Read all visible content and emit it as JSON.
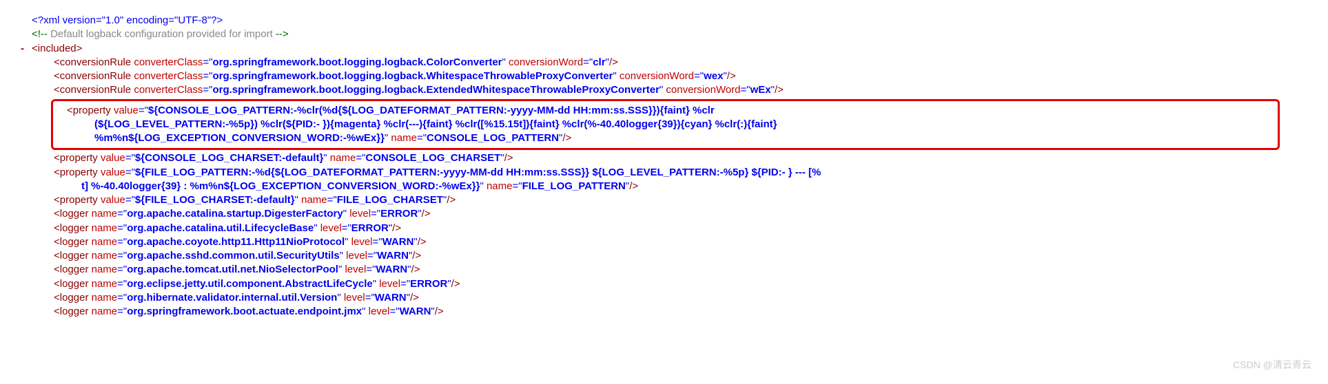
{
  "xmlDecl": "<?xml version=\"1.0\" encoding=\"UTF-8\"?>",
  "comment": " Default logback configuration provided for import ",
  "root": "included",
  "convRules": [
    {
      "class": "org.springframework.boot.logging.logback.ColorConverter",
      "word": "clr"
    },
    {
      "class": "org.springframework.boot.logging.logback.WhitespaceThrowableProxyConverter",
      "word": "wex"
    },
    {
      "class": "org.springframework.boot.logging.logback.ExtendedWhitespaceThrowableProxyConverter",
      "word": "wEx"
    }
  ],
  "props": {
    "console_pattern": {
      "l1": "${CONSOLE_LOG_PATTERN:-%clr(%d{${LOG_DATEFORMAT_PATTERN:-yyyy-MM-dd HH:mm:ss.SSS}}){faint} %clr",
      "l2": "(${LOG_LEVEL_PATTERN:-%5p}) %clr(${PID:- }){magenta} %clr(---){faint} %clr([%15.15t]){faint} %clr(%-40.40logger{39}){cyan} %clr(:){faint}",
      "l3": "%m%n${LOG_EXCEPTION_CONVERSION_WORD:-%wEx}}",
      "name": "CONSOLE_LOG_PATTERN"
    },
    "console_charset": {
      "value": "${CONSOLE_LOG_CHARSET:-default}",
      "name": "CONSOLE_LOG_CHARSET"
    },
    "file_pattern": {
      "l1": "${FILE_LOG_PATTERN:-%d{${LOG_DATEFORMAT_PATTERN:-yyyy-MM-dd HH:mm:ss.SSS}} ${LOG_LEVEL_PATTERN:-%5p} ${PID:- } --- [%",
      "l2": "t] %-40.40logger{39} : %m%n${LOG_EXCEPTION_CONVERSION_WORD:-%wEx}}",
      "name": "FILE_LOG_PATTERN"
    },
    "file_charset": {
      "value": "${FILE_LOG_CHARSET:-default}",
      "name": "FILE_LOG_CHARSET"
    }
  },
  "loggers": [
    {
      "name": "org.apache.catalina.startup.DigesterFactory",
      "level": "ERROR"
    },
    {
      "name": "org.apache.catalina.util.LifecycleBase",
      "level": "ERROR"
    },
    {
      "name": "org.apache.coyote.http11.Http11NioProtocol",
      "level": "WARN"
    },
    {
      "name": "org.apache.sshd.common.util.SecurityUtils",
      "level": "WARN"
    },
    {
      "name": "org.apache.tomcat.util.net.NioSelectorPool",
      "level": "WARN"
    },
    {
      "name": "org.eclipse.jetty.util.component.AbstractLifeCycle",
      "level": "ERROR"
    },
    {
      "name": "org.hibernate.validator.internal.util.Version",
      "level": "WARN"
    },
    {
      "name": "org.springframework.boot.actuate.endpoint.jmx",
      "level": "WARN"
    }
  ],
  "watermark": "CSDN @清云青云"
}
